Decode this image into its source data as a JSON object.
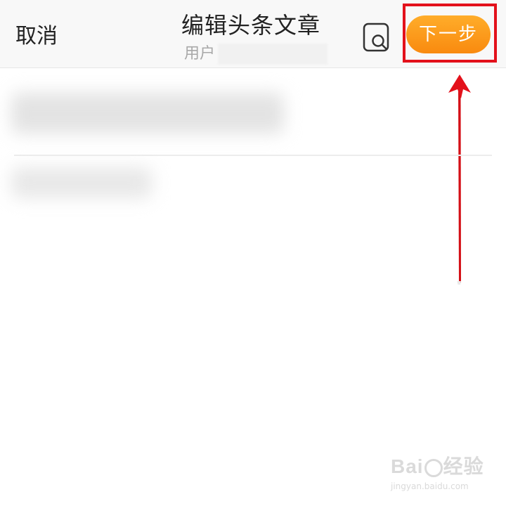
{
  "header": {
    "cancel_label": "取消",
    "title": "编辑头条文章",
    "subtitle_label": "用户",
    "next_label": "下一步"
  },
  "icons": {
    "preview": "search-preview-icon",
    "arrow": "annotation-arrow"
  },
  "colors": {
    "next_button_start": "#ffad2a",
    "next_button_end": "#f98a0f",
    "highlight": "#e3111b",
    "header_background": "#f8f8f8"
  },
  "watermark": {
    "brand_left": "Bai",
    "brand_right": "经验",
    "url": "jingyan.baidu.com"
  }
}
